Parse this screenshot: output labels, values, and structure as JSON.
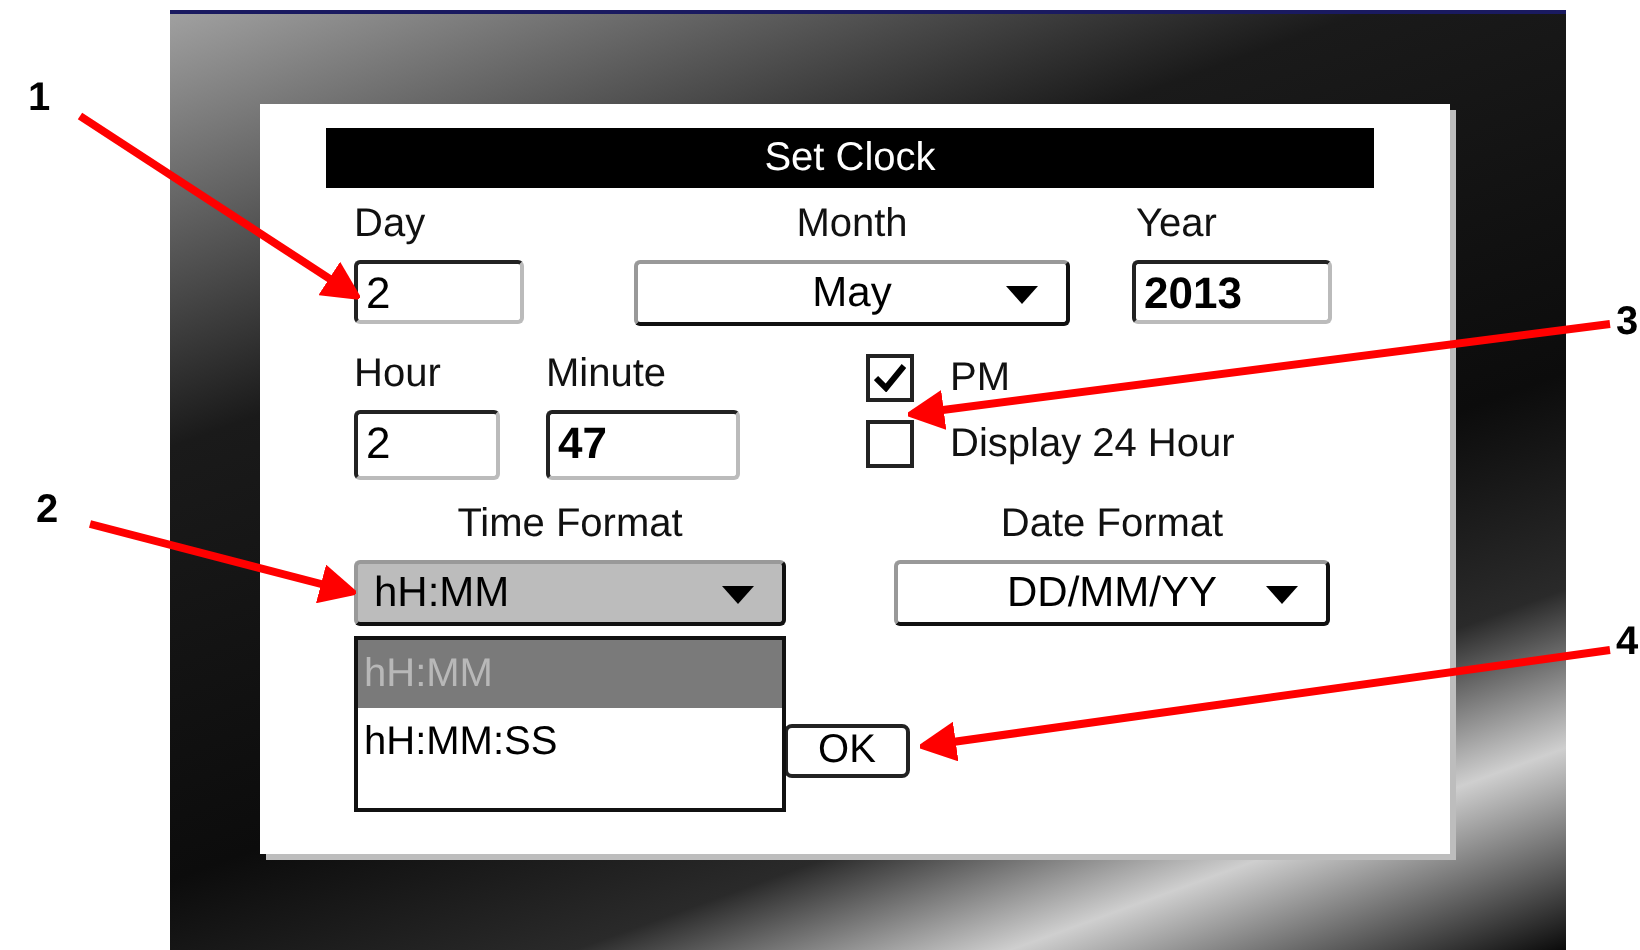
{
  "title": "Set Clock",
  "day": {
    "label": "Day",
    "value": "2"
  },
  "month": {
    "label": "Month",
    "value": "May"
  },
  "year": {
    "label": "Year",
    "value": "2013"
  },
  "hour": {
    "label": "Hour",
    "value": "2"
  },
  "minute": {
    "label": "Minute",
    "value": "47"
  },
  "checkboxes": [
    {
      "label": "PM",
      "checked": true
    },
    {
      "label": "Display 24 Hour",
      "checked": false
    }
  ],
  "time_format": {
    "label": "Time Format",
    "value": "hH:MM",
    "expanded": true,
    "options": [
      {
        "label": "hH:MM",
        "selected": true
      },
      {
        "label": "hH:MM:SS",
        "selected": false
      }
    ]
  },
  "date_format": {
    "label": "Date Format",
    "value": "DD/MM/YY"
  },
  "ok_button": "OK",
  "callouts": [
    "1",
    "2",
    "3",
    "4"
  ]
}
